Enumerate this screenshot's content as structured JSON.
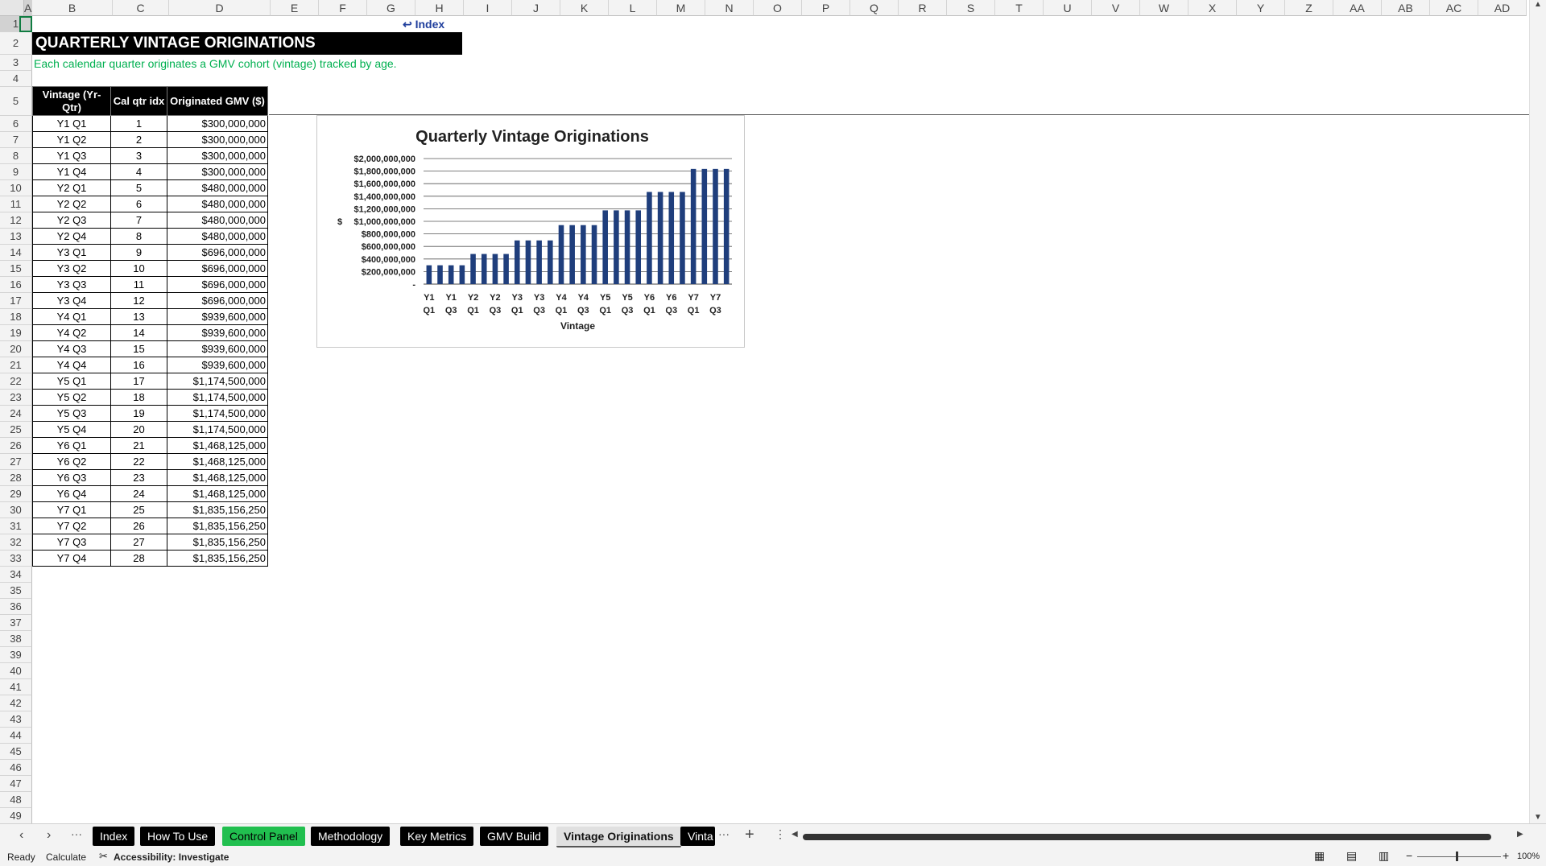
{
  "columns": [
    "A",
    "B",
    "C",
    "D",
    "E",
    "F",
    "G",
    "H",
    "I",
    "J",
    "K",
    "L",
    "M",
    "N",
    "O",
    "P",
    "Q",
    "R",
    "S",
    "T",
    "U",
    "V",
    "W",
    "X",
    "Y",
    "Z",
    "AA",
    "AB",
    "AC",
    "AD"
  ],
  "rows": [
    1,
    2,
    3,
    4,
    5,
    6,
    7,
    8,
    9,
    10,
    11,
    12,
    13,
    14,
    15,
    16,
    17,
    18,
    19,
    20,
    21,
    22,
    23,
    24,
    25,
    26,
    27,
    28,
    29,
    30,
    31,
    32,
    33,
    34,
    35,
    36,
    37,
    38,
    39,
    40,
    41,
    42,
    43,
    44,
    45,
    46,
    47,
    48,
    49
  ],
  "index_link": "↩ Index",
  "sheet_title": "QUARTERLY VINTAGE ORIGINATIONS",
  "subtitle": "Each calendar quarter originates a GMV cohort (vintage) tracked by age.",
  "table": {
    "headers": [
      "Vintage (Yr-Qtr)",
      "Cal qtr idx",
      "Originated GMV ($)"
    ],
    "rows": [
      [
        "Y1 Q1",
        "1",
        "$300,000,000"
      ],
      [
        "Y1 Q2",
        "2",
        "$300,000,000"
      ],
      [
        "Y1 Q3",
        "3",
        "$300,000,000"
      ],
      [
        "Y1 Q4",
        "4",
        "$300,000,000"
      ],
      [
        "Y2 Q1",
        "5",
        "$480,000,000"
      ],
      [
        "Y2 Q2",
        "6",
        "$480,000,000"
      ],
      [
        "Y2 Q3",
        "7",
        "$480,000,000"
      ],
      [
        "Y2 Q4",
        "8",
        "$480,000,000"
      ],
      [
        "Y3 Q1",
        "9",
        "$696,000,000"
      ],
      [
        "Y3 Q2",
        "10",
        "$696,000,000"
      ],
      [
        "Y3 Q3",
        "11",
        "$696,000,000"
      ],
      [
        "Y3 Q4",
        "12",
        "$696,000,000"
      ],
      [
        "Y4 Q1",
        "13",
        "$939,600,000"
      ],
      [
        "Y4 Q2",
        "14",
        "$939,600,000"
      ],
      [
        "Y4 Q3",
        "15",
        "$939,600,000"
      ],
      [
        "Y4 Q4",
        "16",
        "$939,600,000"
      ],
      [
        "Y5 Q1",
        "17",
        "$1,174,500,000"
      ],
      [
        "Y5 Q2",
        "18",
        "$1,174,500,000"
      ],
      [
        "Y5 Q3",
        "19",
        "$1,174,500,000"
      ],
      [
        "Y5 Q4",
        "20",
        "$1,174,500,000"
      ],
      [
        "Y6 Q1",
        "21",
        "$1,468,125,000"
      ],
      [
        "Y6 Q2",
        "22",
        "$1,468,125,000"
      ],
      [
        "Y6 Q3",
        "23",
        "$1,468,125,000"
      ],
      [
        "Y6 Q4",
        "24",
        "$1,468,125,000"
      ],
      [
        "Y7 Q1",
        "25",
        "$1,835,156,250"
      ],
      [
        "Y7 Q2",
        "26",
        "$1,835,156,250"
      ],
      [
        "Y7 Q3",
        "27",
        "$1,835,156,250"
      ],
      [
        "Y7 Q4",
        "28",
        "$1,835,156,250"
      ]
    ]
  },
  "chart_data": {
    "type": "bar",
    "title": "Quarterly Vintage Originations",
    "xlabel": "Vintage",
    "ylabel": "$",
    "ylim": [
      0,
      2000000000
    ],
    "yticks": [
      "-",
      "$200,000,000",
      "$400,000,000",
      "$600,000,000",
      "$800,000,000",
      "$1,000,000,000",
      "$1,200,000,000",
      "$1,400,000,000",
      "$1,600,000,000",
      "$1,800,000,000",
      "$2,000,000,000"
    ],
    "categories": [
      "Y1 Q1",
      "Y1 Q2",
      "Y1 Q3",
      "Y1 Q4",
      "Y2 Q1",
      "Y2 Q2",
      "Y2 Q3",
      "Y2 Q4",
      "Y3 Q1",
      "Y3 Q2",
      "Y3 Q3",
      "Y3 Q4",
      "Y4 Q1",
      "Y4 Q2",
      "Y4 Q3",
      "Y4 Q4",
      "Y5 Q1",
      "Y5 Q2",
      "Y5 Q3",
      "Y5 Q4",
      "Y6 Q1",
      "Y6 Q2",
      "Y6 Q3",
      "Y6 Q4",
      "Y7 Q1",
      "Y7 Q2",
      "Y7 Q3",
      "Y7 Q4"
    ],
    "values": [
      300000000,
      300000000,
      300000000,
      300000000,
      480000000,
      480000000,
      480000000,
      480000000,
      696000000,
      696000000,
      696000000,
      696000000,
      939600000,
      939600000,
      939600000,
      939600000,
      1174500000,
      1174500000,
      1174500000,
      1174500000,
      1468125000,
      1468125000,
      1468125000,
      1468125000,
      1835156250,
      1835156250,
      1835156250,
      1835156250
    ],
    "xtick_labels": [
      [
        "Y1",
        "Q1"
      ],
      [
        "Y1",
        "Q3"
      ],
      [
        "Y2",
        "Q1"
      ],
      [
        "Y2",
        "Q3"
      ],
      [
        "Y3",
        "Q1"
      ],
      [
        "Y3",
        "Q3"
      ],
      [
        "Y4",
        "Q1"
      ],
      [
        "Y4",
        "Q3"
      ],
      [
        "Y5",
        "Q1"
      ],
      [
        "Y5",
        "Q3"
      ],
      [
        "Y6",
        "Q1"
      ],
      [
        "Y6",
        "Q3"
      ],
      [
        "Y7",
        "Q1"
      ],
      [
        "Y7",
        "Q3"
      ]
    ],
    "bar_color": "#1f3e7c",
    "grid": true,
    "legend": false
  },
  "tabs": [
    {
      "label": "Index",
      "style": "dark"
    },
    {
      "label": "How To Use",
      "style": "dark"
    },
    {
      "label": "Control Panel",
      "style": "green"
    },
    {
      "label": "Methodology",
      "style": "dark"
    },
    {
      "label": "Key Metrics",
      "style": "dark"
    },
    {
      "label": "GMV Build",
      "style": "dark"
    },
    {
      "label": "Vintage Originations",
      "style": "active"
    },
    {
      "label": "Vinta",
      "style": "dark"
    }
  ],
  "status": {
    "ready": "Ready",
    "calculate": "Calculate",
    "accessibility": "Accessibility: Investigate",
    "zoom": "100%"
  },
  "colors": {
    "title_bg": "#000000",
    "subtitle": "#00b050",
    "link": "#1f3e9c",
    "tab_green": "#21bf4f"
  }
}
